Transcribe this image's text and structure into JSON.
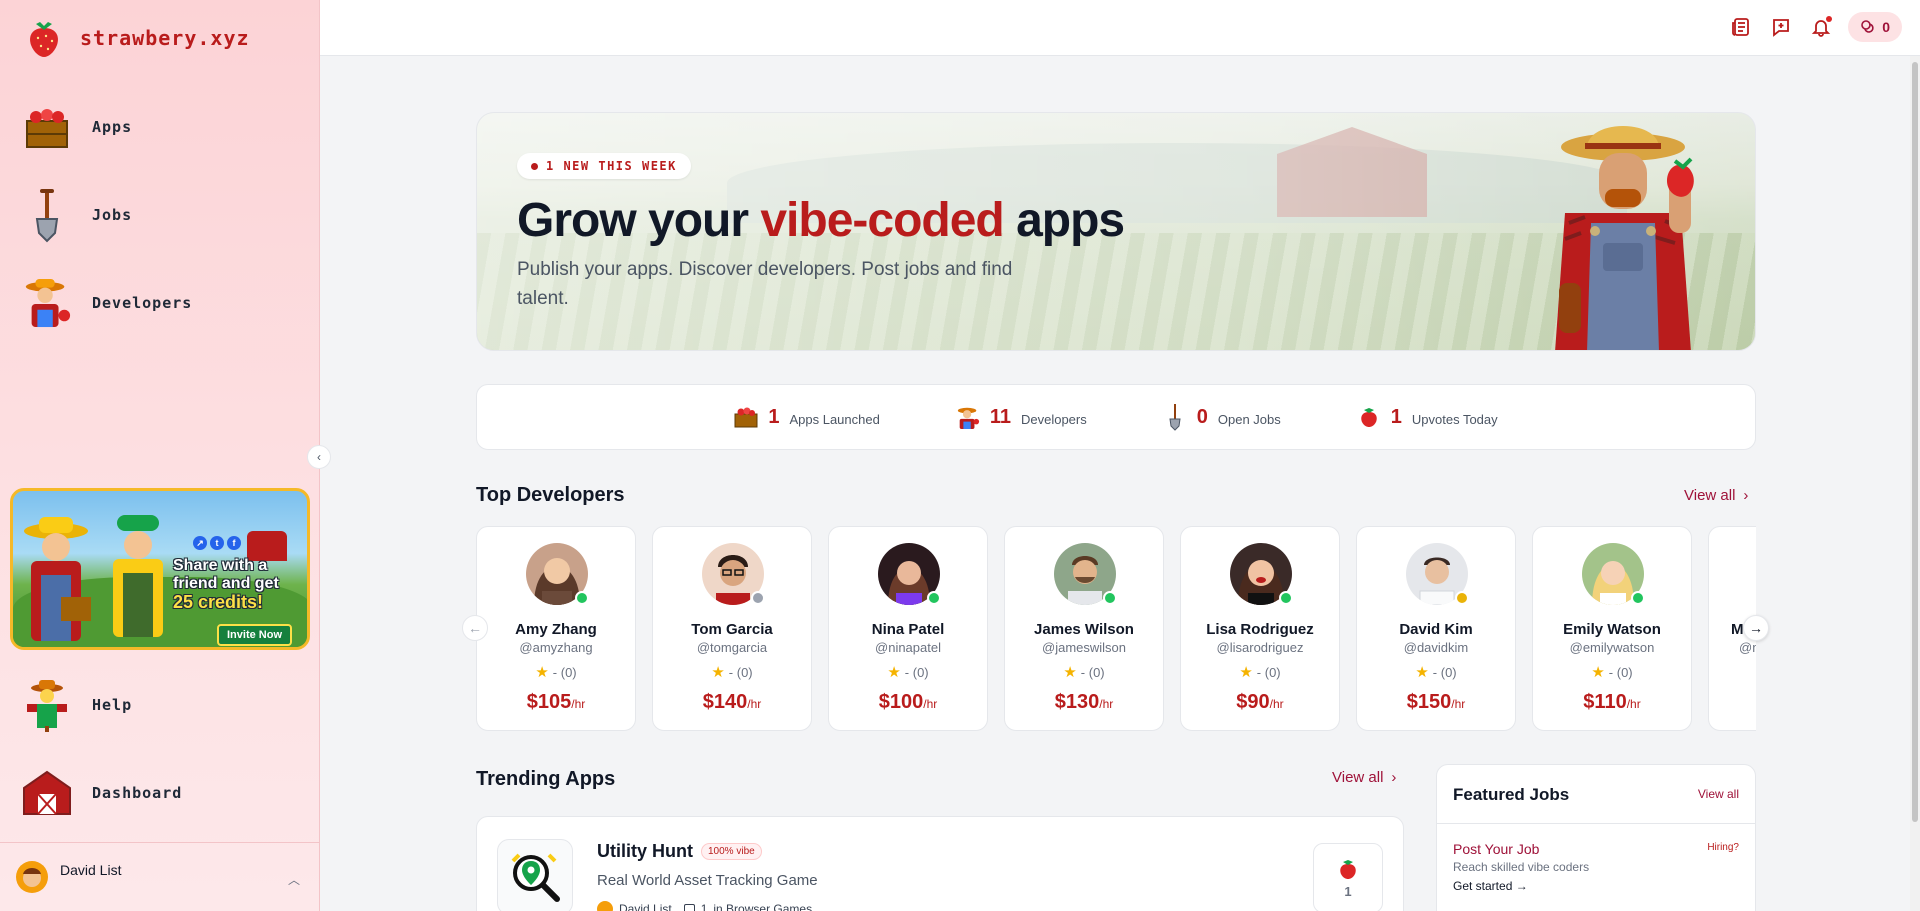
{
  "brand": {
    "name": "strawbery.xyz"
  },
  "sidebar": {
    "items": [
      {
        "label": "Apps",
        "icon": "crate-icon"
      },
      {
        "label": "Jobs",
        "icon": "shovel-icon"
      },
      {
        "label": "Developers",
        "icon": "farmer-icon"
      },
      {
        "label": "Help",
        "icon": "scarecrow-icon"
      },
      {
        "label": "Dashboard",
        "icon": "barn-icon"
      }
    ],
    "promo": {
      "line1": "Share with a",
      "line2": "friend and get",
      "line3": "25 credits!",
      "button": "Invite Now"
    },
    "user": {
      "name": "David List"
    }
  },
  "header": {
    "credits": "0"
  },
  "hero": {
    "badge": "1 NEW THIS WEEK",
    "title_part1": "Grow your ",
    "title_accent": "vibe-coded",
    "title_part2": " apps",
    "subtitle": "Publish your apps. Discover developers. Post jobs and find talent."
  },
  "stats": [
    {
      "value": "1",
      "label": "Apps Launched",
      "icon": "crate-icon"
    },
    {
      "value": "11",
      "label": "Developers",
      "icon": "farmer-icon"
    },
    {
      "value": "0",
      "label": "Open Jobs",
      "icon": "shovel-icon"
    },
    {
      "value": "1",
      "label": "Upvotes Today",
      "icon": "strawberry-icon"
    }
  ],
  "top_developers": {
    "title": "Top Developers",
    "view_all": "View all",
    "devs": [
      {
        "name": "Amy Zhang",
        "handle": "@amyzhang",
        "rating": "- (0)",
        "rate": "$105",
        "unit": "/hr",
        "status": "online"
      },
      {
        "name": "Tom Garcia",
        "handle": "@tomgarcia",
        "rating": "- (0)",
        "rate": "$140",
        "unit": "/hr",
        "status": "offline"
      },
      {
        "name": "Nina Patel",
        "handle": "@ninapatel",
        "rating": "- (0)",
        "rate": "$100",
        "unit": "/hr",
        "status": "online"
      },
      {
        "name": "James Wilson",
        "handle": "@jameswilson",
        "rating": "- (0)",
        "rate": "$130",
        "unit": "/hr",
        "status": "online"
      },
      {
        "name": "Lisa Rodriguez",
        "handle": "@lisarodriguez",
        "rating": "- (0)",
        "rate": "$90",
        "unit": "/hr",
        "status": "online"
      },
      {
        "name": "David Kim",
        "handle": "@davidkim",
        "rating": "- (0)",
        "rate": "$150",
        "unit": "/hr",
        "status": "away"
      },
      {
        "name": "Emily Watson",
        "handle": "@emilywatson",
        "rating": "- (0)",
        "rate": "$110",
        "unit": "/hr",
        "status": "online"
      },
      {
        "name": "M",
        "handle": "@m",
        "rating": "",
        "rate": "",
        "unit": "",
        "status": "online"
      }
    ]
  },
  "trending_apps": {
    "title": "Trending Apps",
    "view_all": "View all",
    "apps": [
      {
        "name": "Utility Hunt",
        "badge": "100% vibe",
        "description": "Real World Asset Tracking Game",
        "author": "David List",
        "count": "1",
        "category": "in Browser Games",
        "upvotes": "1"
      }
    ]
  },
  "featured_jobs": {
    "title": "Featured Jobs",
    "view_all": "View all",
    "job": {
      "title": "Post Your Job",
      "tag": "Hiring?",
      "description": "Reach skilled vibe coders",
      "cta": "Get started →"
    }
  },
  "colors": {
    "accent": "#b91c1c",
    "sidebar_bg": "#fcd3d6",
    "online": "#22c55e",
    "offline": "#9ca3af",
    "away": "#eab308"
  }
}
